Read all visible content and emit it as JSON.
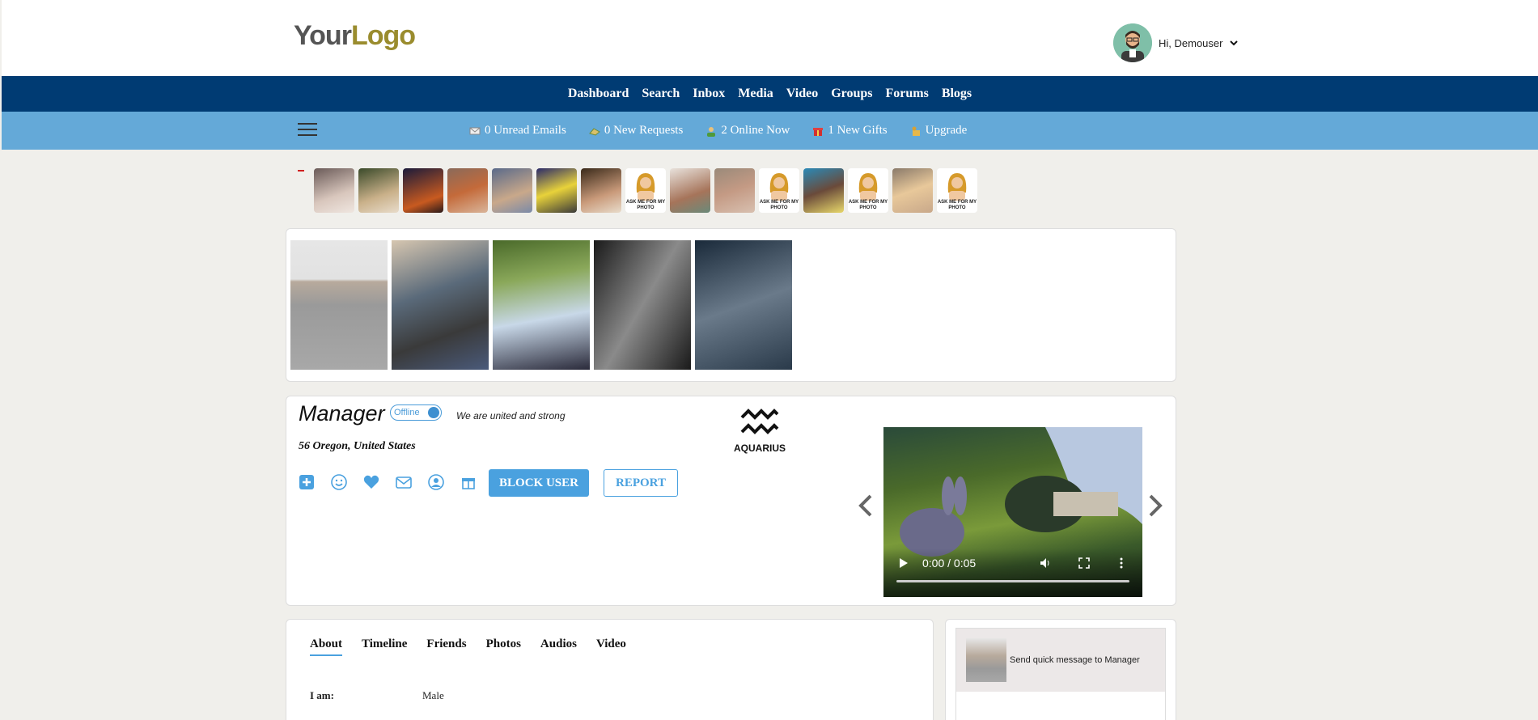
{
  "header": {
    "logo_part1": "Your",
    "logo_part2": "Logo",
    "greeting": "Hi, Demouser"
  },
  "main_nav": [
    "Dashboard",
    "Search",
    "Inbox",
    "Media",
    "Video",
    "Groups",
    "Forums",
    "Blogs"
  ],
  "sub_nav": {
    "unread_emails": "0 Unread Emails",
    "new_requests": "0 New Requests",
    "online_now": "2 Online Now",
    "new_gifts": "1 New Gifts",
    "upgrade": "Upgrade"
  },
  "thumb_ask_label": "ASK ME FOR MY PHOTO",
  "profile": {
    "name": "Manager",
    "status": "Offline",
    "motto": "We are united and strong",
    "location": "56 Oregon, United States",
    "block_label": "BLOCK USER",
    "report_label": "REPORT",
    "zodiac": "AQUARIUS",
    "video_time": "0:00 / 0:05"
  },
  "tabs": [
    "About",
    "Timeline",
    "Friends",
    "Photos",
    "Audios",
    "Video"
  ],
  "about": {
    "i_am_label": "I am:",
    "i_am_value": "Male"
  },
  "quick_message": {
    "text": "Send quick message to  Manager"
  },
  "colors": {
    "main_nav_bg": "#003b73",
    "sub_nav_bg": "#64a9d8",
    "accent": "#4aa1df"
  }
}
